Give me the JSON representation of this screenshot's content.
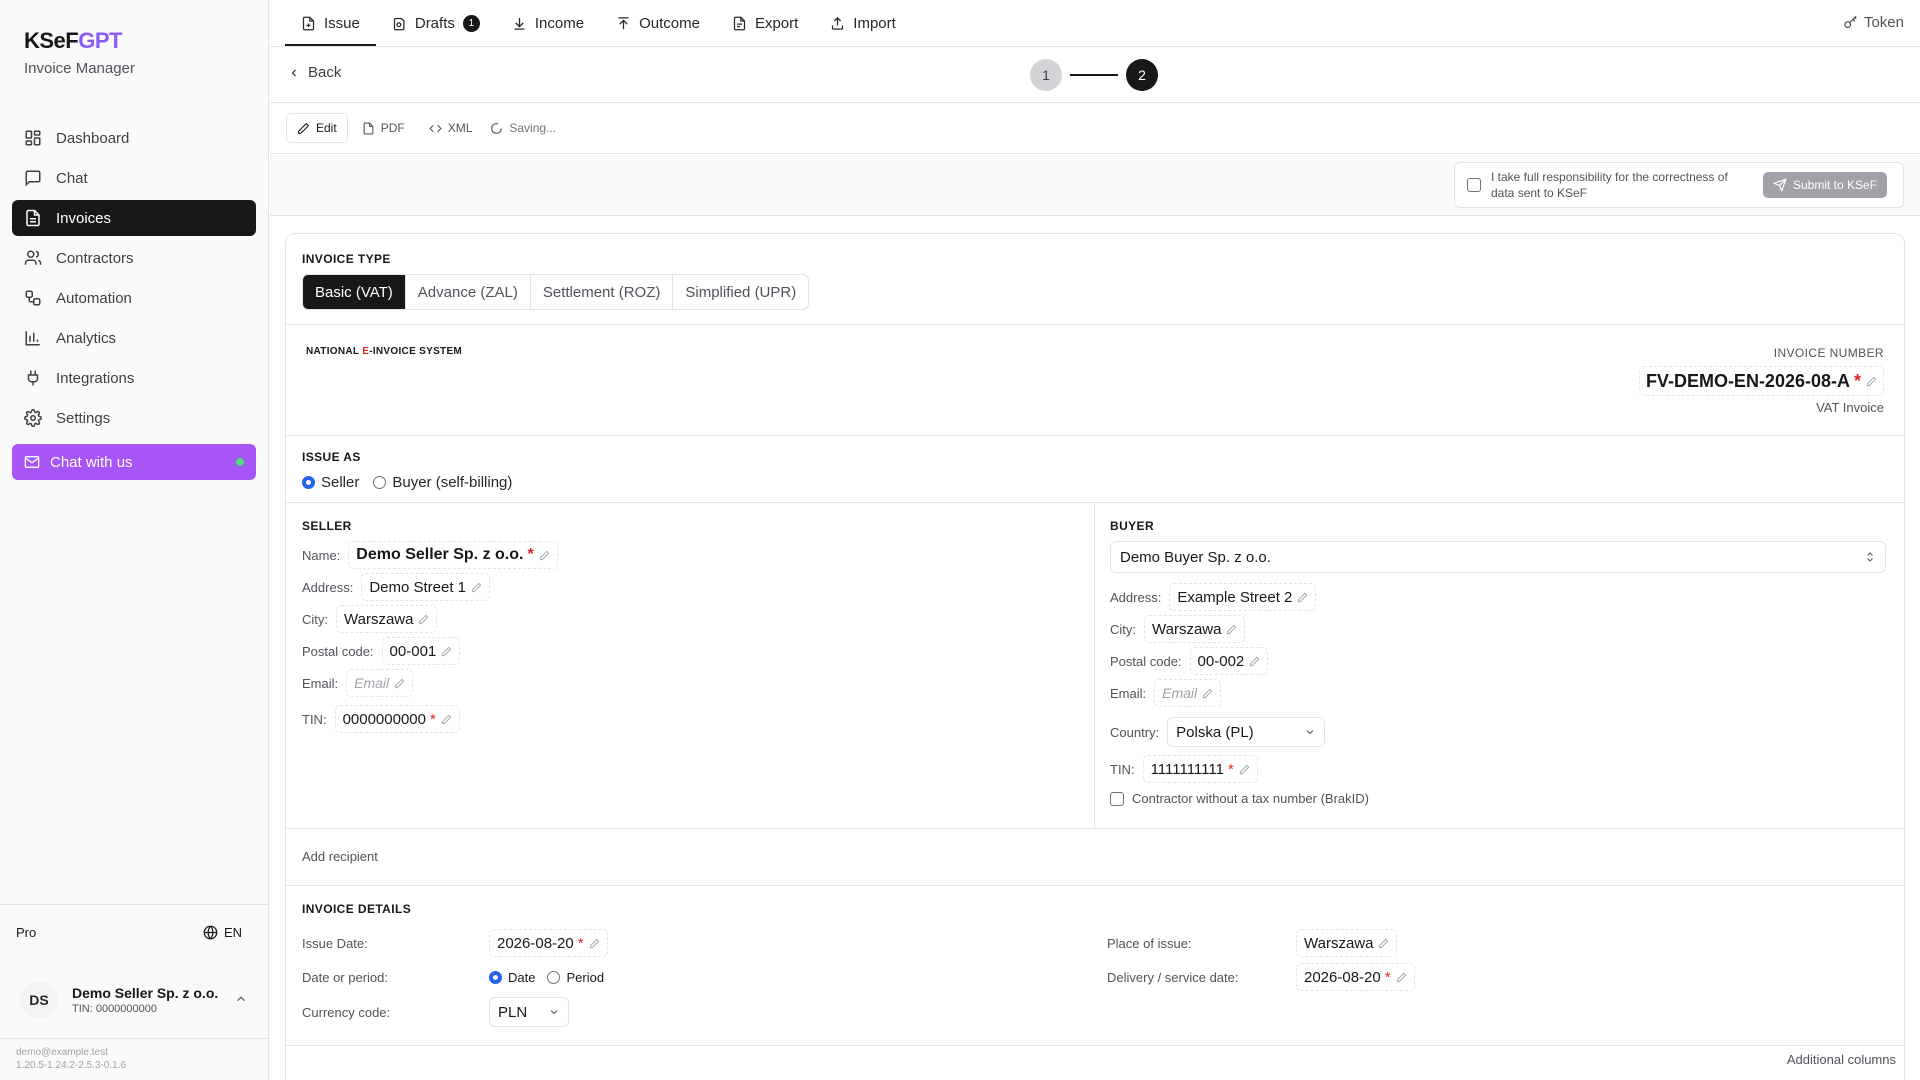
{
  "brand": {
    "logo_k": "KSeF",
    "logo_g": "GPT",
    "subtitle": "Invoice Manager"
  },
  "nav": {
    "items": [
      {
        "label": "Dashboard",
        "icon": "dashboard-icon"
      },
      {
        "label": "Chat",
        "icon": "chat-icon"
      },
      {
        "label": "Invoices",
        "icon": "file-icon",
        "active": true
      },
      {
        "label": "Contractors",
        "icon": "users-icon"
      },
      {
        "label": "Automation",
        "icon": "workflow-icon"
      },
      {
        "label": "Analytics",
        "icon": "bar-chart-icon"
      },
      {
        "label": "Integrations",
        "icon": "plug-icon"
      },
      {
        "label": "Settings",
        "icon": "gear-icon"
      }
    ],
    "chat_with_us": "Chat with us"
  },
  "plan": {
    "name": "Pro",
    "lang": "EN"
  },
  "user": {
    "initials": "DS",
    "name": "Demo Seller Sp. z o.o.",
    "tin": "TIN: 0000000000"
  },
  "footer": {
    "email": "demo@example.test",
    "version": "1.20.5-1.24.2-2.5.3-0.1.6"
  },
  "tabs": [
    {
      "label": "Issue",
      "icon": "file-plus-icon",
      "active": true
    },
    {
      "label": "Drafts",
      "icon": "drafts-icon",
      "badge": "1"
    },
    {
      "label": "Income",
      "icon": "download-icon"
    },
    {
      "label": "Outcome",
      "icon": "upload-icon"
    },
    {
      "label": "Export",
      "icon": "file-export-icon"
    },
    {
      "label": "Import",
      "icon": "import-icon"
    }
  ],
  "token_label": "Token",
  "back_label": "Back",
  "stepper": {
    "step1": "1",
    "step2": "2"
  },
  "modes": {
    "edit": "Edit",
    "pdf": "PDF",
    "xml": "XML",
    "saving": "Saving..."
  },
  "submit": {
    "responsibility": "I take full responsibility for the correctness of data sent to KSeF",
    "button": "Submit to KSeF"
  },
  "invoice_type": {
    "label": "INVOICE TYPE",
    "options": [
      "Basic (VAT)",
      "Advance (ZAL)",
      "Settlement (ROZ)",
      "Simplified (UPR)"
    ]
  },
  "ksef_logo": {
    "pre": "NATIONAL ",
    "red": "E",
    "post": "-INVOICE SYSTEM"
  },
  "invoice_number": {
    "label": "INVOICE NUMBER",
    "value": "FV-DEMO-EN-2026-08-A",
    "type": "VAT Invoice"
  },
  "issue_as": {
    "label": "ISSUE AS",
    "seller": "Seller",
    "buyer": "Buyer (self-billing)"
  },
  "seller": {
    "label": "SELLER",
    "name_label": "Name:",
    "name": "Demo Seller Sp. z o.o.",
    "address_label": "Address:",
    "address": "Demo Street 1",
    "city_label": "City:",
    "city": "Warszawa",
    "postal_label": "Postal code:",
    "postal": "00-001",
    "email_label": "Email:",
    "email_placeholder": "Email",
    "tin_label": "TIN:",
    "tin": "0000000000"
  },
  "buyer": {
    "label": "BUYER",
    "select": "Demo Buyer Sp. z o.o.",
    "address_label": "Address:",
    "address": "Example Street 2",
    "city_label": "City:",
    "city": "Warszawa",
    "postal_label": "Postal code:",
    "postal": "00-002",
    "email_label": "Email:",
    "email_placeholder": "Email",
    "country_label": "Country:",
    "country": "Polska (PL)",
    "tin_label": "TIN:",
    "tin": "1111111111",
    "no_tin": "Contractor without a tax number (BrakID)"
  },
  "add_recipient": "Add recipient",
  "details": {
    "label": "INVOICE DETAILS",
    "issue_date_label": "Issue Date:",
    "issue_date": "2026-08-20",
    "date_or_period_label": "Date or period:",
    "date": "Date",
    "period": "Period",
    "currency_label": "Currency code:",
    "currency": "PLN",
    "place_label": "Place of issue:",
    "place": "Warszawa",
    "delivery_label": "Delivery / service date:",
    "delivery": "2026-08-20"
  },
  "additional_columns": "Additional columns",
  "colors": {
    "accent": "#a855f7",
    "brand_gpt": "#8b5cf6",
    "active_bg": "#18181b",
    "required": "#dc2626",
    "radio": "#2563eb"
  }
}
